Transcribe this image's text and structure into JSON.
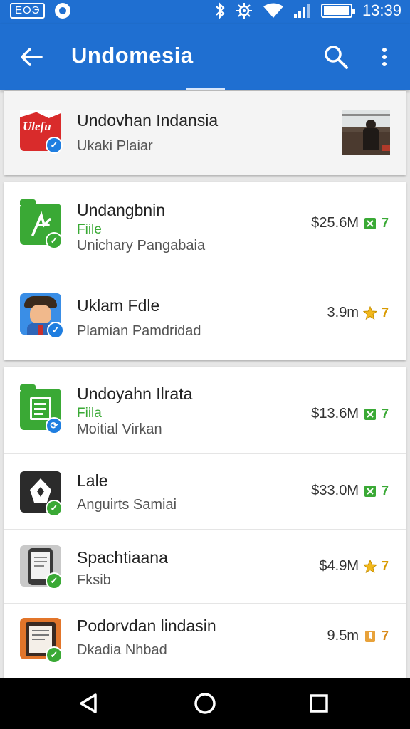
{
  "status_bar": {
    "box_text": "ЕОЭ",
    "time": "13:39",
    "icons": [
      "notification-icon",
      "bluetooth-icon",
      "settings-sync-icon",
      "wifi-icon",
      "signal-icon",
      "battery-icon"
    ]
  },
  "app_bar": {
    "title": "Undomesia",
    "color": "#1f6fd1",
    "icons": [
      "back-arrow-icon",
      "search-icon",
      "more-vert-icon"
    ]
  },
  "featured": {
    "icon_text": "Ulefu",
    "title": "Undovhan Indansia",
    "subtitle": "Ukaki Plaiar"
  },
  "group1": [
    {
      "title": "Undangbnin",
      "file": "Fiile",
      "subtitle": "Unichary Pangabaia",
      "meta": "$25.6M",
      "meta_num": "7",
      "meta_icon": "book-icon",
      "icon_color": "#3aa935",
      "icon": "folder-icon",
      "badge": "green"
    },
    {
      "title": "Uklam Fdle",
      "file": "",
      "subtitle": "Plamian  Pamdridad",
      "meta": "3.9m",
      "meta_num": "7",
      "meta_icon": "star-icon",
      "icon_color": "#2a7fdc",
      "icon": "avatar-icon",
      "badge": "blue"
    }
  ],
  "group2": [
    {
      "title": "Undoyahn Ilrata",
      "file": "Fiila",
      "subtitle": "Moitial Virkan",
      "meta": "$13.6M",
      "meta_num": "7",
      "meta_icon": "book-icon",
      "icon_color": "#3aa935",
      "icon": "folder-doc-icon",
      "badge": "blue"
    },
    {
      "title": "Lale",
      "file": "",
      "subtitle": "Anguirts Samiai",
      "meta": "$33.0M",
      "meta_num": "7",
      "meta_icon": "book-icon",
      "icon_color": "#2b2b2b",
      "icon": "dark-app-icon",
      "badge": "green"
    },
    {
      "title": "Spachtiaana",
      "file": "",
      "subtitle": "Fksib",
      "meta": "$4.9M",
      "meta_num": "7",
      "meta_icon": "star-icon",
      "icon_color": "#9a9a9a",
      "icon": "phone-icon",
      "badge": "green"
    },
    {
      "title": "Podorvdan lindasin",
      "file": "",
      "subtitle": "Dkadia Nhbad",
      "meta": "9.5m",
      "meta_num": "7",
      "meta_icon": "bookmark-icon",
      "icon_color": "#e2752a",
      "icon": "ebook-icon",
      "badge": "green"
    }
  ],
  "nav_bar": {
    "icons": [
      "back-triangle-icon",
      "home-circle-icon",
      "recents-square-icon"
    ]
  }
}
